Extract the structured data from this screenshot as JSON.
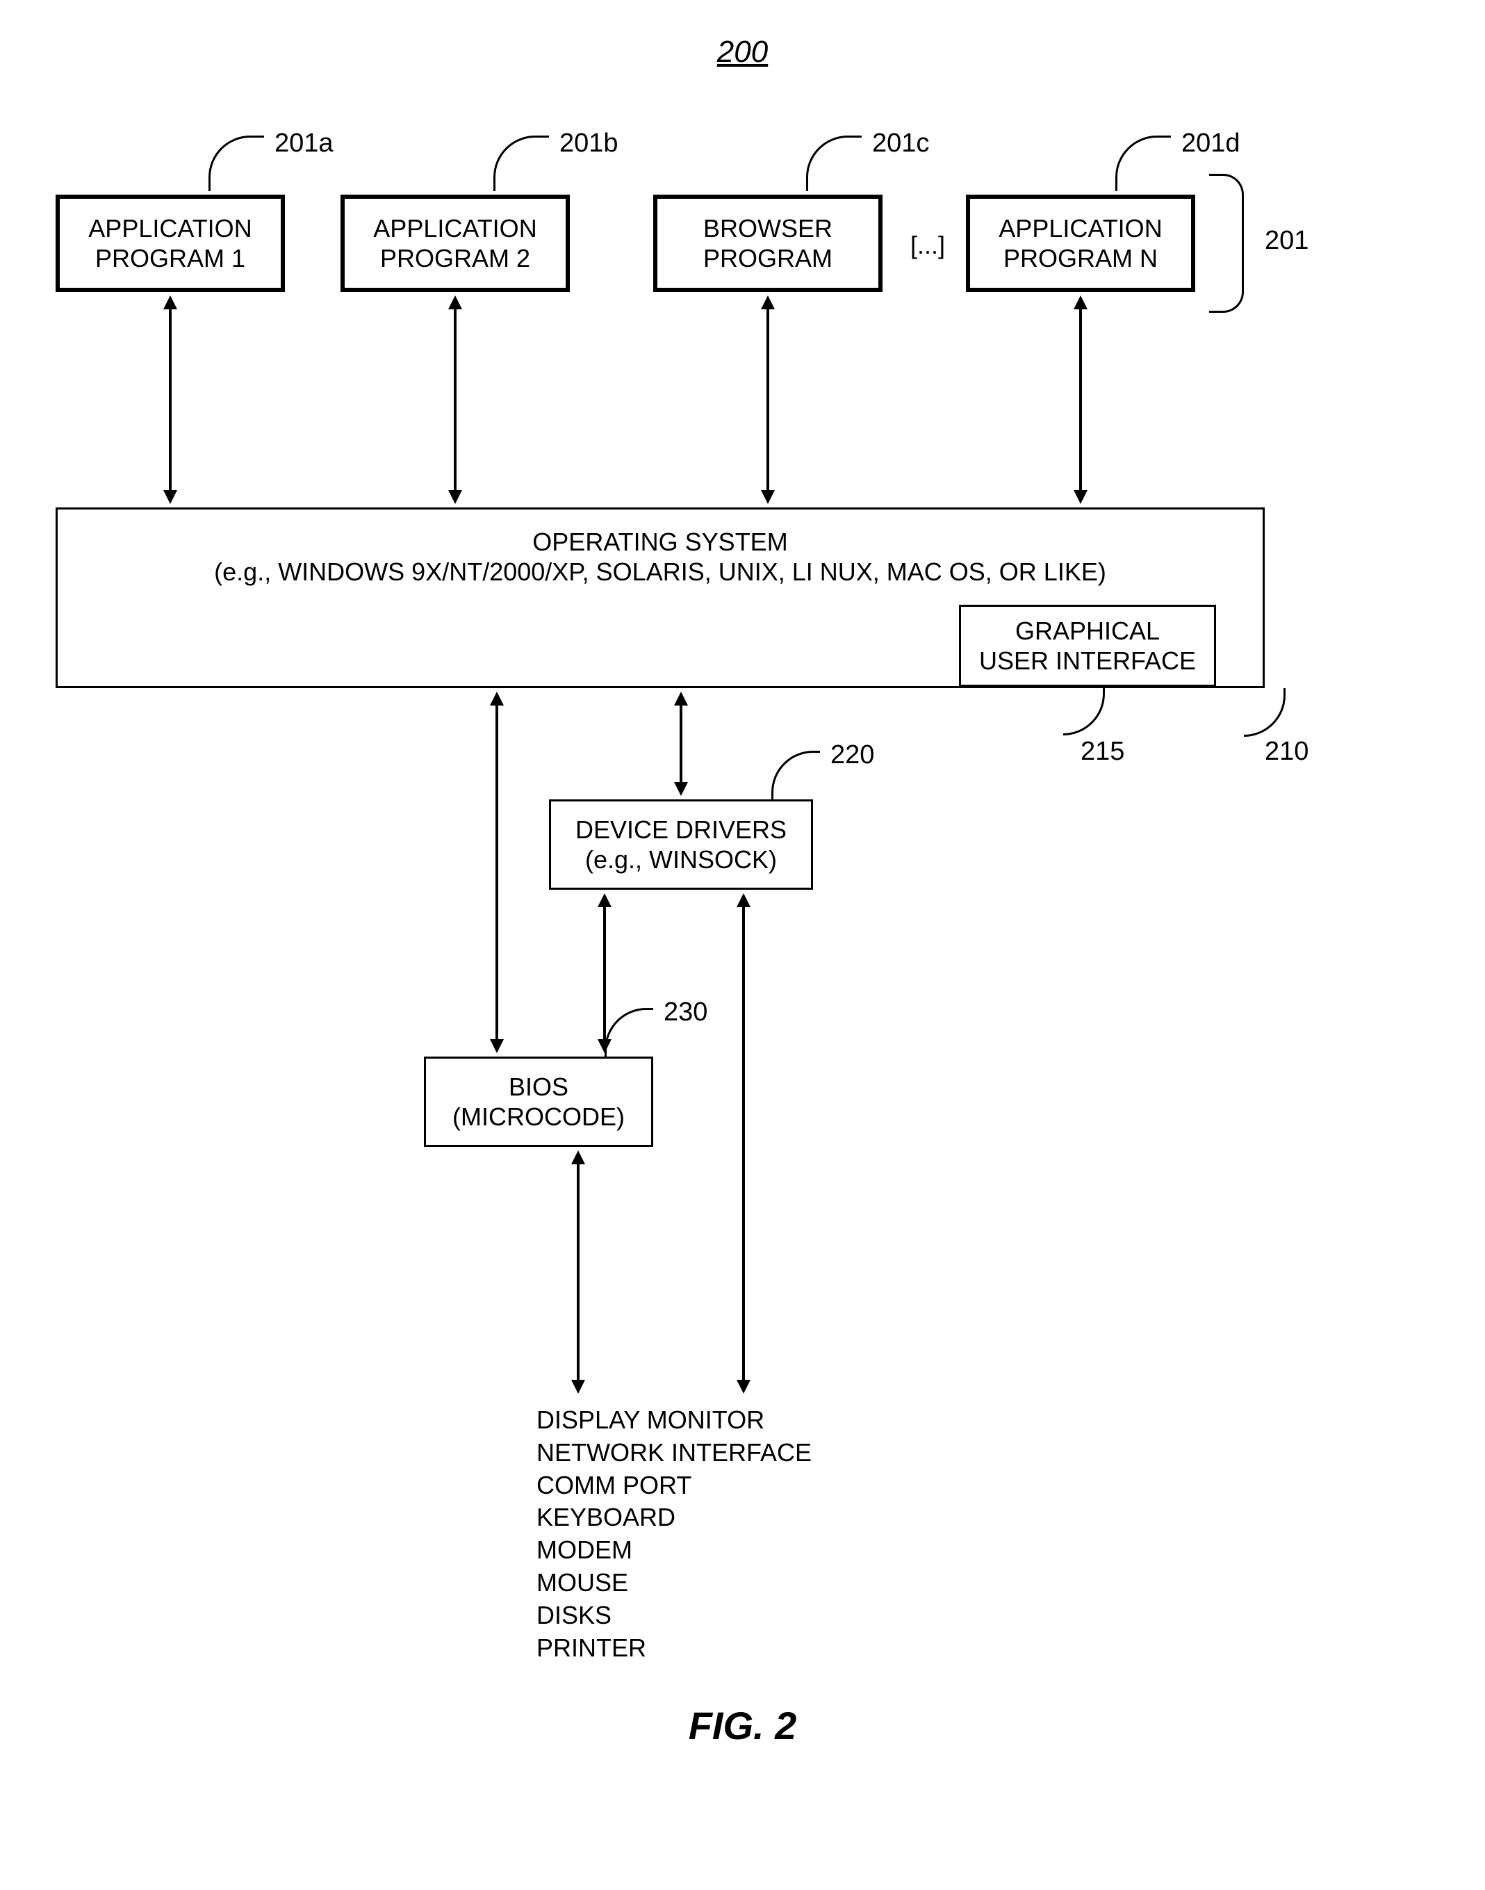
{
  "figure": {
    "number_label": "200",
    "caption": "FIG. 2"
  },
  "apps": {
    "a": {
      "line1": "APPLICATION",
      "line2": "PROGRAM 1",
      "ref": "201a"
    },
    "b": {
      "line1": "APPLICATION",
      "line2": "PROGRAM 2",
      "ref": "201b"
    },
    "c": {
      "line1": "BROWSER",
      "line2": "PROGRAM",
      "ref": "201c"
    },
    "d": {
      "line1": "APPLICATION",
      "line2": "PROGRAM N",
      "ref": "201d"
    },
    "ellipsis": "[...]",
    "group_ref": "201"
  },
  "os": {
    "line1": "OPERATING SYSTEM",
    "line2": "(e.g., WINDOWS 9X/NT/2000/XP, SOLARIS, UNIX, LI NUX, MAC OS, OR LIKE)",
    "ref": "210"
  },
  "gui": {
    "line1": "GRAPHICAL",
    "line2": "USER INTERFACE",
    "ref": "215"
  },
  "drivers": {
    "line1": "DEVICE DRIVERS",
    "line2": "(e.g., WINSOCK)",
    "ref": "220"
  },
  "bios": {
    "line1": "BIOS",
    "line2": "(MICROCODE)",
    "ref": "230"
  },
  "devices": [
    "DISPLAY MONITOR",
    "NETWORK INTERFACE",
    "COMM PORT",
    "KEYBOARD",
    "MODEM",
    "MOUSE",
    "DISKS",
    "PRINTER"
  ]
}
